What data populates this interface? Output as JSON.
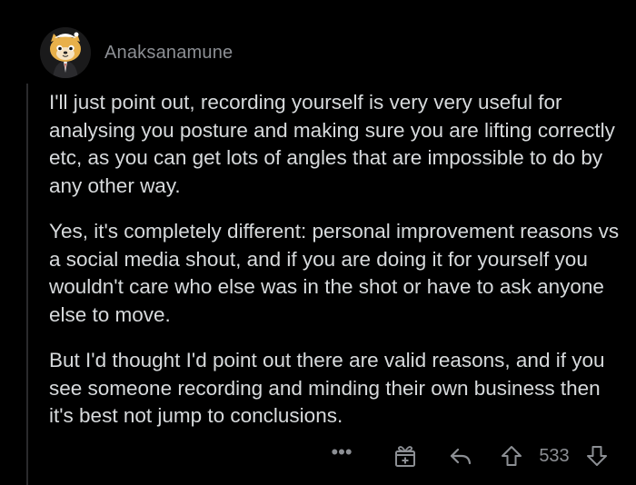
{
  "comment": {
    "username": "Anaksanamune",
    "avatar_icon": "snoo-avatar-icon",
    "paragraphs": [
      "I'll just point out, recording yourself is very very useful for analysing you posture and making sure you are lifting correctly etc, as you can get lots of angles that are impossible to do by any other way.",
      "Yes, it's completely different: personal improvement reasons vs a social media shout, and if you are doing it for yourself you wouldn't care who else was in the shot or have to ask anyone else to move.",
      "But I'd thought I'd point out there are valid reasons, and if you see someone recording and minding their own business then it's best not jump to conclusions."
    ]
  },
  "actions": {
    "more_label": "•••",
    "award_icon": "award-icon",
    "reply_icon": "reply-icon",
    "upvote_icon": "upvote-arrow-icon",
    "score": "533",
    "downvote_icon": "downvote-arrow-icon"
  },
  "colors": {
    "background": "#000000",
    "text": "#d7dadc",
    "muted": "#8c8f94",
    "thread_line": "#2a2a2c"
  }
}
